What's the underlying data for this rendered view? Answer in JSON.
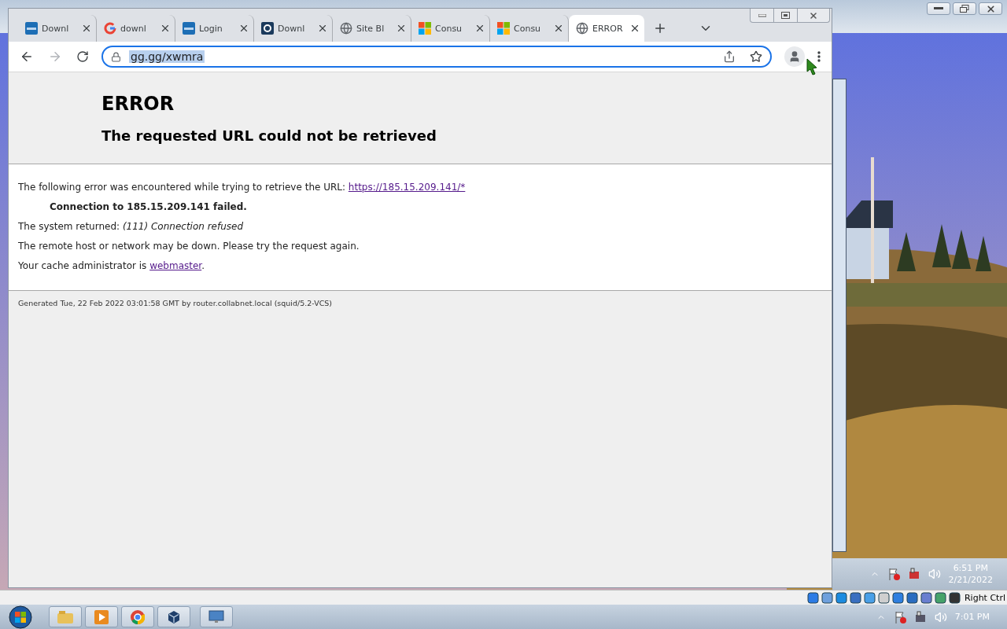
{
  "browser": {
    "tabs": [
      {
        "title": "Downl",
        "kind": "vmw",
        "selected": false
      },
      {
        "title": "downl",
        "kind": "google",
        "selected": false
      },
      {
        "title": "Login",
        "kind": "vmw",
        "selected": false
      },
      {
        "title": "Downl",
        "kind": "q",
        "selected": false
      },
      {
        "title": "Site Bl",
        "kind": "globe",
        "selected": false
      },
      {
        "title": "Consu",
        "kind": "ms",
        "selected": false
      },
      {
        "title": "Consu",
        "kind": "ms",
        "selected": false
      },
      {
        "title": "ERROR",
        "kind": "globe",
        "selected": true
      }
    ],
    "address": "gg.gg/xwmra",
    "page": {
      "heading": "ERROR",
      "subheading": "The requested URL could not be retrieved",
      "paragraphs": [
        {
          "kind": "link",
          "text": "The following error was encountered while trying to retrieve the URL: ",
          "link": "https://185.15.209.141/*"
        },
        {
          "kind": "bold",
          "text": "Connection to 185.15.209.141 failed."
        },
        {
          "kind": "plain",
          "text": "The system returned: *(111) Connection refused*"
        },
        {
          "kind": "plain",
          "text": "The remote host or network may be down. Please try the request again."
        },
        {
          "kind": "link",
          "text": "Your cache administrator is ",
          "link": "webmaster",
          "after": "."
        }
      ],
      "footer": "Generated Tue, 22 Feb 2022 03:01:58 GMT by router.collabnet.local (squid/5.2-VCS)"
    }
  },
  "guest_taskbar": {
    "time": "6:51 PM",
    "date": "2/21/2022"
  },
  "vm_status_bar": {
    "host_key": "Right Ctrl"
  },
  "host_taskbar": {
    "apps": [
      {
        "kind": "folder"
      },
      {
        "kind": "media"
      },
      {
        "kind": "chrome"
      },
      {
        "kind": "vbox"
      },
      {
        "kind": "monitor"
      }
    ],
    "time": "7:01 PM"
  }
}
